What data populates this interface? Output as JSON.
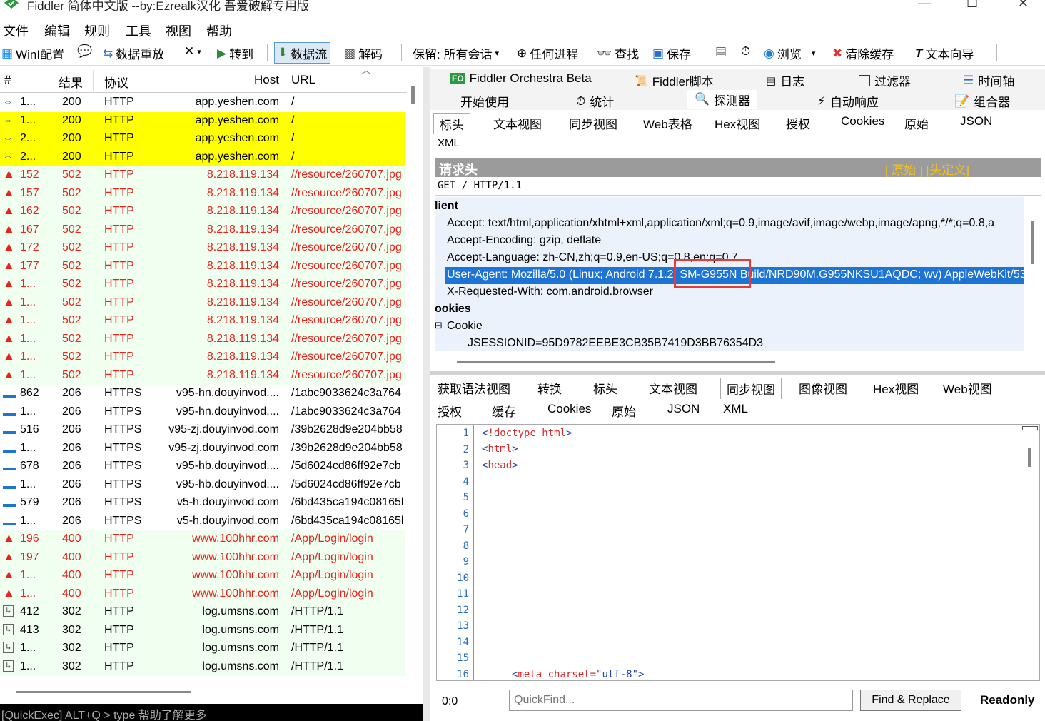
{
  "window": {
    "title": "Fiddler 简体中文版 --by:Ezrealk汉化 吾爱破解专用版"
  },
  "menu": [
    "文件",
    "编辑",
    "规则",
    "工具",
    "视图",
    "帮助"
  ],
  "toolbar": {
    "winconfig": "WinI配置",
    "replay": "数据重放",
    "goto": "转到",
    "stream": "数据流",
    "decode": "解码",
    "keep": "保留: 所有会话",
    "process": "任何进程",
    "find": "查找",
    "save": "保存",
    "browse": "浏览",
    "clear_cache": "清除缓存",
    "text_wizard": "文本向导"
  },
  "sessions": {
    "headers": {
      "num": "#",
      "result": "结果",
      "protocol": "协议",
      "host": "Host",
      "url": "URL"
    },
    "rows": [
      {
        "icon": "arrows",
        "id": "1...",
        "result": "200",
        "protocol": "HTTP",
        "host": "app.yeshen.com",
        "url": "/",
        "style": "normal"
      },
      {
        "icon": "arrows",
        "id": "1...",
        "result": "200",
        "protocol": "HTTP",
        "host": "app.yeshen.com",
        "url": "/",
        "style": "yellow"
      },
      {
        "icon": "arrows",
        "id": "2...",
        "result": "200",
        "protocol": "HTTP",
        "host": "app.yeshen.com",
        "url": "/",
        "style": "yellow"
      },
      {
        "icon": "arrows",
        "id": "2...",
        "result": "200",
        "protocol": "HTTP",
        "host": "app.yeshen.com",
        "url": "/",
        "style": "yellow"
      },
      {
        "icon": "warn",
        "id": "152",
        "result": "502",
        "protocol": "HTTP",
        "host": "8.218.119.134",
        "url": "//resource/260707.jpg",
        "style": "red"
      },
      {
        "icon": "warn",
        "id": "157",
        "result": "502",
        "protocol": "HTTP",
        "host": "8.218.119.134",
        "url": "//resource/260707.jpg",
        "style": "red"
      },
      {
        "icon": "warn",
        "id": "162",
        "result": "502",
        "protocol": "HTTP",
        "host": "8.218.119.134",
        "url": "//resource/260707.jpg",
        "style": "red"
      },
      {
        "icon": "warn",
        "id": "167",
        "result": "502",
        "protocol": "HTTP",
        "host": "8.218.119.134",
        "url": "//resource/260707.jpg",
        "style": "red"
      },
      {
        "icon": "warn",
        "id": "172",
        "result": "502",
        "protocol": "HTTP",
        "host": "8.218.119.134",
        "url": "//resource/260707.jpg",
        "style": "red"
      },
      {
        "icon": "warn",
        "id": "177",
        "result": "502",
        "protocol": "HTTP",
        "host": "8.218.119.134",
        "url": "//resource/260707.jpg",
        "style": "red"
      },
      {
        "icon": "warn",
        "id": "1...",
        "result": "502",
        "protocol": "HTTP",
        "host": "8.218.119.134",
        "url": "//resource/260707.jpg",
        "style": "red"
      },
      {
        "icon": "warn",
        "id": "1...",
        "result": "502",
        "protocol": "HTTP",
        "host": "8.218.119.134",
        "url": "//resource/260707.jpg",
        "style": "red"
      },
      {
        "icon": "warn",
        "id": "1...",
        "result": "502",
        "protocol": "HTTP",
        "host": "8.218.119.134",
        "url": "//resource/260707.jpg",
        "style": "red"
      },
      {
        "icon": "warn",
        "id": "1...",
        "result": "502",
        "protocol": "HTTP",
        "host": "8.218.119.134",
        "url": "//resource/260707.jpg",
        "style": "red"
      },
      {
        "icon": "warn",
        "id": "1...",
        "result": "502",
        "protocol": "HTTP",
        "host": "8.218.119.134",
        "url": "//resource/260707.jpg",
        "style": "red"
      },
      {
        "icon": "warn",
        "id": "1...",
        "result": "502",
        "protocol": "HTTP",
        "host": "8.218.119.134",
        "url": "//resource/260707.jpg",
        "style": "red"
      },
      {
        "icon": "dash",
        "id": "862",
        "result": "206",
        "protocol": "HTTPS",
        "host": "v95-hn.douyinvod....",
        "url": "/1abc9033624c3a764",
        "style": "normal"
      },
      {
        "icon": "dash",
        "id": "1...",
        "result": "206",
        "protocol": "HTTPS",
        "host": "v95-hn.douyinvod....",
        "url": "/1abc9033624c3a764",
        "style": "normal"
      },
      {
        "icon": "dash",
        "id": "516",
        "result": "206",
        "protocol": "HTTPS",
        "host": "v95-zj.douyinvod.com",
        "url": "/39b2628d9e204bb58",
        "style": "normal"
      },
      {
        "icon": "dash",
        "id": "1...",
        "result": "206",
        "protocol": "HTTPS",
        "host": "v95-zj.douyinvod.com",
        "url": "/39b2628d9e204bb58",
        "style": "normal"
      },
      {
        "icon": "dash",
        "id": "678",
        "result": "206",
        "protocol": "HTTPS",
        "host": "v95-hb.douyinvod....",
        "url": "/5d6024cd86ff92e7cb",
        "style": "normal"
      },
      {
        "icon": "dash",
        "id": "1...",
        "result": "206",
        "protocol": "HTTPS",
        "host": "v95-hb.douyinvod....",
        "url": "/5d6024cd86ff92e7cb",
        "style": "normal"
      },
      {
        "icon": "dash",
        "id": "579",
        "result": "206",
        "protocol": "HTTPS",
        "host": "v5-h.douyinvod.com",
        "url": "/6bd435ca194c08165l",
        "style": "normal"
      },
      {
        "icon": "dash",
        "id": "1...",
        "result": "206",
        "protocol": "HTTPS",
        "host": "v5-h.douyinvod.com",
        "url": "/6bd435ca194c08165l",
        "style": "normal"
      },
      {
        "icon": "warn",
        "id": "196",
        "result": "400",
        "protocol": "HTTP",
        "host": "www.100hhr.com",
        "url": "/App/Login/login",
        "style": "red"
      },
      {
        "icon": "warn",
        "id": "197",
        "result": "400",
        "protocol": "HTTP",
        "host": "www.100hhr.com",
        "url": "/App/Login/login",
        "style": "red"
      },
      {
        "icon": "warn",
        "id": "1...",
        "result": "400",
        "protocol": "HTTP",
        "host": "www.100hhr.com",
        "url": "/App/Login/login",
        "style": "red"
      },
      {
        "icon": "warn",
        "id": "1...",
        "result": "400",
        "protocol": "HTTP",
        "host": "www.100hhr.com",
        "url": "/App/Login/login",
        "style": "red"
      },
      {
        "icon": "redirect",
        "id": "412",
        "result": "302",
        "protocol": "HTTP",
        "host": "log.umsns.com",
        "url": "/HTTP/1.1",
        "style": "green"
      },
      {
        "icon": "redirect",
        "id": "413",
        "result": "302",
        "protocol": "HTTP",
        "host": "log.umsns.com",
        "url": "/HTTP/1.1",
        "style": "green"
      },
      {
        "icon": "redirect",
        "id": "1...",
        "result": "302",
        "protocol": "HTTP",
        "host": "log.umsns.com",
        "url": "/HTTP/1.1",
        "style": "green"
      },
      {
        "icon": "redirect",
        "id": "1...",
        "result": "302",
        "protocol": "HTTP",
        "host": "log.umsns.com",
        "url": "/HTTP/1.1",
        "style": "green"
      }
    ]
  },
  "quickexec": "[QuickExec] ALT+Q > type 帮助了解更多",
  "top_tabs": {
    "row1": [
      "Fiddler Orchestra Beta",
      "Fiddler脚本",
      "日志",
      "过滤器",
      "时间轴"
    ],
    "row2": [
      "开始使用",
      "统计",
      "探测器",
      "自动响应",
      "组合器"
    ]
  },
  "request_tabs": [
    "标头",
    "文本视图",
    "同步视图",
    "Web表格",
    "Hex视图",
    "授权",
    "Cookies",
    "原始",
    "JSON",
    "XML"
  ],
  "request": {
    "section_title": "请求头",
    "links": "[ 原始 ]  [头定义]",
    "request_line": "GET / HTTP/1.1",
    "group_client": "lient",
    "accept": "Accept: text/html,application/xhtml+xml,application/xml;q=0.9,image/avif,image/webp,image/apng,*/*;q=0.8,a",
    "accept_encoding": "Accept-Encoding: gzip, deflate",
    "accept_language": "Accept-Language: zh-CN,zh;q=0.9,en-US;q=0.8,en;q=0.7",
    "user_agent": "User-Agent: Mozilla/5.0 (Linux; Android 7.1.2; SM-G955N Build/NRD90M.G955NKSU1AQDC; wv) AppleWebKit/53",
    "x_requested_with": "X-Requested-With: com.android.browser",
    "group_cookies": "ookies",
    "cookie": "Cookie",
    "jsessionid": "JSESSIONID=95D9782EEBE3CB35B7419D3BB76354D3"
  },
  "response_tabs": {
    "row1": [
      "获取语法视图",
      "转换",
      "标头",
      "文本视图",
      "同步视图",
      "图像视图",
      "Hex视图",
      "Web视图"
    ],
    "row2": [
      "授权",
      "缓存",
      "Cookies",
      "原始",
      "JSON",
      "XML"
    ]
  },
  "code": {
    "line_numbers": [
      "1",
      "2",
      "3",
      "4",
      "5",
      "6",
      "7",
      "8",
      "9",
      "10",
      "11",
      "12",
      "13",
      "14",
      "15",
      "16"
    ],
    "line1": "<!doctype html>",
    "line2": "<html>",
    "line3": "<head>",
    "line16": "<meta charset=\"utf-8\">"
  },
  "status": {
    "position": "0:0",
    "quickfind_placeholder": "QuickFind...",
    "find_replace": "Find & Replace",
    "readonly": "Readonly"
  },
  "colors": {
    "yellow_row": "#ffff00",
    "red_text": "#e8221c",
    "red_bg": "#f0fff0",
    "selected": "#1e74d4",
    "header_bar": "#9b9b9b"
  }
}
